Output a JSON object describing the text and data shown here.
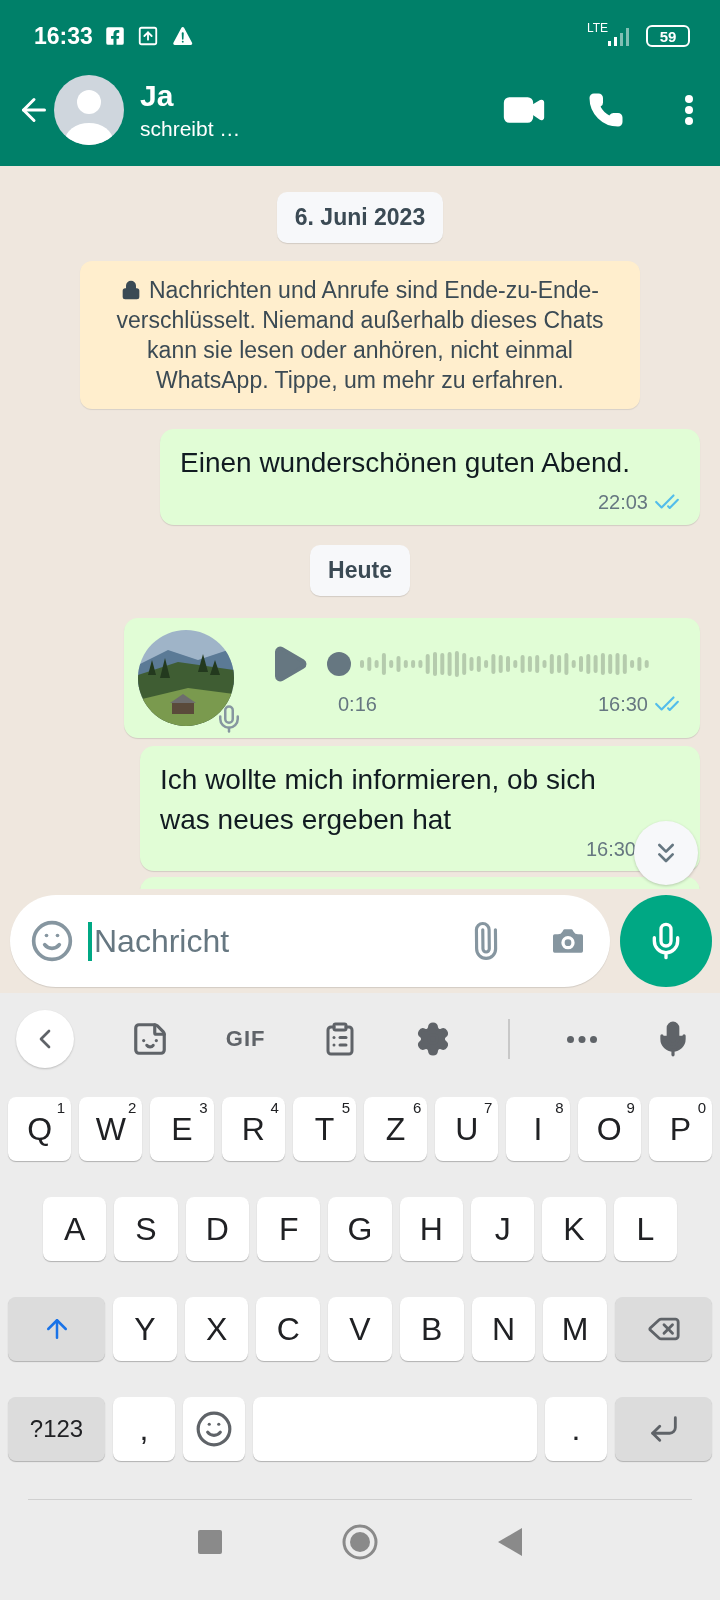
{
  "status_bar": {
    "time": "16:33",
    "network": "LTE",
    "battery": "59"
  },
  "header": {
    "name": "Ja",
    "status": "schreibt …"
  },
  "messages": [
    {
      "kind": "date",
      "text": "6. Juni 2023"
    },
    {
      "kind": "notice",
      "text": "Nachrichten und Anrufe sind Ende-zu-Ende-verschlüsselt. Niemand außerhalb dieses Chats kann sie lesen oder anhören, nicht einmal WhatsApp. Tippe, um mehr zu erfahren."
    },
    {
      "kind": "text",
      "text": "Einen wunderschönen guten Abend.",
      "time": "22:03",
      "read": true
    },
    {
      "kind": "date",
      "text": "Heute"
    },
    {
      "kind": "voice",
      "duration": "0:16",
      "time": "16:30",
      "read": true
    },
    {
      "kind": "text",
      "text": "Ich wollte mich informieren, ob sich was neues ergeben hat",
      "time": "16:30"
    },
    {
      "kind": "cut"
    }
  ],
  "composer": {
    "placeholder": "Nachricht"
  },
  "keyboard": {
    "gif_label": "GIF",
    "rows": [
      [
        {
          "kind": "letter",
          "label": "Q",
          "hint": "1"
        },
        {
          "kind": "letter",
          "label": "W",
          "hint": "2"
        },
        {
          "kind": "letter",
          "label": "E",
          "hint": "3"
        },
        {
          "kind": "letter",
          "label": "R",
          "hint": "4"
        },
        {
          "kind": "letter",
          "label": "T",
          "hint": "5"
        },
        {
          "kind": "letter",
          "label": "Z",
          "hint": "6"
        },
        {
          "kind": "letter",
          "label": "U",
          "hint": "7"
        },
        {
          "kind": "letter",
          "label": "I",
          "hint": "8"
        },
        {
          "kind": "letter",
          "label": "O",
          "hint": "9"
        },
        {
          "kind": "letter",
          "label": "P",
          "hint": "0"
        }
      ],
      [
        {
          "kind": "letter",
          "label": "A"
        },
        {
          "kind": "letter",
          "label": "S"
        },
        {
          "kind": "letter",
          "label": "D"
        },
        {
          "kind": "letter",
          "label": "F"
        },
        {
          "kind": "letter",
          "label": "G"
        },
        {
          "kind": "letter",
          "label": "H"
        },
        {
          "kind": "letter",
          "label": "J"
        },
        {
          "kind": "letter",
          "label": "K"
        },
        {
          "kind": "letter",
          "label": "L"
        }
      ],
      [
        {
          "kind": "shift",
          "on": true
        },
        {
          "kind": "letter",
          "label": "Y"
        },
        {
          "kind": "letter",
          "label": "X"
        },
        {
          "kind": "letter",
          "label": "C"
        },
        {
          "kind": "letter",
          "label": "V"
        },
        {
          "kind": "letter",
          "label": "B"
        },
        {
          "kind": "letter",
          "label": "N"
        },
        {
          "kind": "letter",
          "label": "M"
        },
        {
          "kind": "backspace"
        }
      ]
    ],
    "bottom_row": [
      {
        "kind": "symbols",
        "label": "?123"
      },
      {
        "kind": "letter",
        "label": ","
      },
      {
        "kind": "emoji"
      },
      {
        "kind": "space"
      },
      {
        "kind": "letter",
        "label": "."
      },
      {
        "kind": "enter"
      }
    ]
  }
}
